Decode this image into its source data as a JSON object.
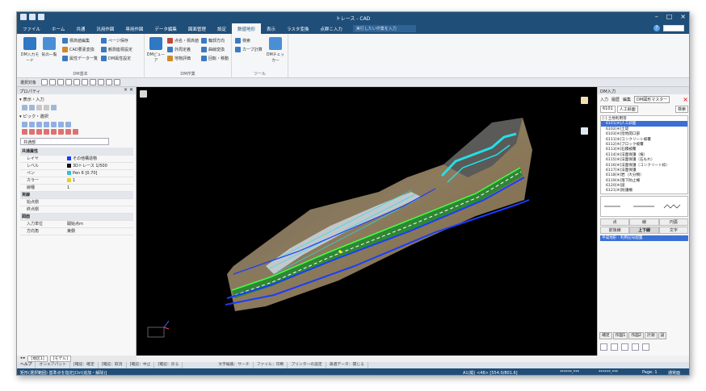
{
  "window": {
    "title": "トレース - CAD"
  },
  "ribbon_tabs": [
    {
      "label": "ファイル",
      "active": false
    },
    {
      "label": "ホーム",
      "active": false
    },
    {
      "label": "共通",
      "active": false
    },
    {
      "label": "汎用作図",
      "active": false
    },
    {
      "label": "専用作図",
      "active": false
    },
    {
      "label": "データ編集",
      "active": false
    },
    {
      "label": "図面管理",
      "active": false
    },
    {
      "label": "設定",
      "active": false
    },
    {
      "label": "数値地形",
      "active": true
    },
    {
      "label": "表示",
      "active": false
    },
    {
      "label": "ラスタ変換",
      "active": false
    },
    {
      "label": "点群こ入力",
      "active": false
    }
  ],
  "tellme": "実行したい作業を入力",
  "ribbon": {
    "groups": [
      {
        "label": "DM基本"
      },
      {
        "label": "DM作業"
      },
      {
        "label": "ツール"
      }
    ],
    "big_buttons": [
      {
        "label": "DM入力モード",
        "color": "#2f78c4"
      },
      {
        "label": "気の一覧",
        "color": "#4a8fd6"
      },
      {
        "label": "DMビューア",
        "color": "#2f78c4"
      },
      {
        "label": "DMチェッカー",
        "color": "#4a8fd6"
      }
    ],
    "small_col1": [
      {
        "label": "標高値編集",
        "color": "#3c7ac0"
      },
      {
        "label": "CAD要素変換",
        "color": "#d08a2a"
      },
      {
        "label": "属性データ一覧",
        "color": "#3c7ac0"
      }
    ],
    "small_col2": [
      {
        "label": "ページ保存",
        "color": "#3c7ac0"
      },
      {
        "label": "観測座標設定",
        "color": "#3c7ac0"
      },
      {
        "label": "DM属性設定",
        "color": "#3c7ac0"
      }
    ],
    "small_col3": [
      {
        "label": "点名・標高値",
        "color": "#c04a3c"
      },
      {
        "label": "外周定義",
        "color": "#3c7ac0"
      },
      {
        "label": "地物評価",
        "color": "#d08a2a"
      }
    ],
    "small_col4": [
      {
        "label": "輪郭方向",
        "color": "#3c7ac0"
      },
      {
        "label": "曲線変換",
        "color": "#3c7ac0"
      },
      {
        "label": "回転・移動",
        "color": "#3c7ac0"
      }
    ],
    "small_col5": [
      {
        "label": "検索",
        "color": "#3c7ac0"
      },
      {
        "label": "カーブ計算",
        "color": "#3c7ac0"
      }
    ]
  },
  "toolstrip": {
    "label": "選択対象"
  },
  "left_panel": {
    "title": "プロパティ",
    "section_display": "表示・入力",
    "section_pick": "ピック・選択",
    "select_value": "共通部",
    "rows": [
      {
        "type": "cat",
        "k": "共通属性",
        "v": ""
      },
      {
        "type": "row",
        "k": "レイヤ",
        "v": "その他構造物",
        "swatch": "#1a3cff"
      },
      {
        "type": "row",
        "k": "レベル",
        "v": "3Dトレース 1/500",
        "swatch": "#111111"
      },
      {
        "type": "row",
        "k": "ペン",
        "v": "Pen 6 [0.70]",
        "swatch": "#30c0e0"
      },
      {
        "type": "row",
        "k": "カラー",
        "v": "1",
        "swatch": "#e8d020"
      },
      {
        "type": "row",
        "k": "線種",
        "v": "1",
        "swatch": ""
      },
      {
        "type": "cat",
        "k": "実線",
        "v": ""
      },
      {
        "type": "row",
        "k": "始点側",
        "v": "",
        "swatch": ""
      },
      {
        "type": "row",
        "k": "終点側",
        "v": "",
        "swatch": ""
      },
      {
        "type": "cat",
        "k": "図面",
        "v": ""
      },
      {
        "type": "row",
        "k": "入力単位",
        "v": "開始点m",
        "swatch": ""
      },
      {
        "type": "row",
        "k": "方向角",
        "v": "東側",
        "swatch": ""
      }
    ]
  },
  "right_panel": {
    "title": "DM入力",
    "tabs": [
      "入力",
      "履歴",
      "編集"
    ],
    "dropdown": "DM図形マスター",
    "code": "6101",
    "layer_name": "人工斜面",
    "search_label": "検索",
    "layers": [
      {
        "label": "[-] 土地利用等",
        "selected": false,
        "head": true
      },
      {
        "label": "6101[※]人工斜面",
        "selected": true,
        "head": false
      },
      {
        "label": "6102[※]土堤",
        "selected": false,
        "head": false
      },
      {
        "label": "6103[※]窪地開口部",
        "selected": false,
        "head": false
      },
      {
        "label": "6111[※]コンクリート被覆",
        "selected": false,
        "head": false
      },
      {
        "label": "6112[※]ブロック被覆",
        "selected": false,
        "head": false
      },
      {
        "label": "6113[※]石積被覆",
        "selected": false,
        "head": false
      },
      {
        "label": "6114[※]法面保護（植）",
        "selected": false,
        "head": false
      },
      {
        "label": "6115[※]法面保護（石もれ）",
        "selected": false,
        "head": false
      },
      {
        "label": "6116[※]法面保護（コンクリート枠）",
        "selected": false,
        "head": false
      },
      {
        "label": "6117[※]法面保護",
        "selected": false,
        "head": false
      },
      {
        "label": "6118[※]岩（大分類）",
        "selected": false,
        "head": false
      },
      {
        "label": "6119[※]落下防止柵",
        "selected": false,
        "head": false
      },
      {
        "label": "6120[※]崖",
        "selected": false,
        "head": false
      },
      {
        "label": "6121[※]防護柵",
        "selected": false,
        "head": false
      }
    ],
    "btn_row1": [
      "点",
      "線",
      "円弧"
    ],
    "btn_row2": [
      "前後線",
      "上下線",
      "文字"
    ],
    "selected_line": "平成地形 - 利用記号配置",
    "bottom_tabs": [
      "補足",
      "作図1",
      "作図2",
      "計測",
      "設"
    ]
  },
  "sheet_tabs": [
    "[地区1]",
    "[モデル]"
  ],
  "cmdbar": [
    "ヘルプ",
    "オンエアパット",
    "[確認：確定",
    "[確認：取消",
    "[確認：中止",
    "[確認：戻る",
    "文字編集：サーチ",
    "ファイル：印刷",
    "プリンターの設定",
    "表選データ：開じる"
  ],
  "status": {
    "left": "矩形(選択範囲) 基準点を指定[Ctrl(追加・解除)]",
    "coords": "A1(縦) <46> [554.0/801.6]",
    "stars1": "******,***",
    "stars2": "******,***",
    "page": "Page: 1",
    "mode": "通常面"
  },
  "colors": {
    "title_bar": "#1f4e79",
    "accent_blue": "#1a3cff",
    "road_green": "#33cc33",
    "cyan_structure": "#22e0e8"
  }
}
